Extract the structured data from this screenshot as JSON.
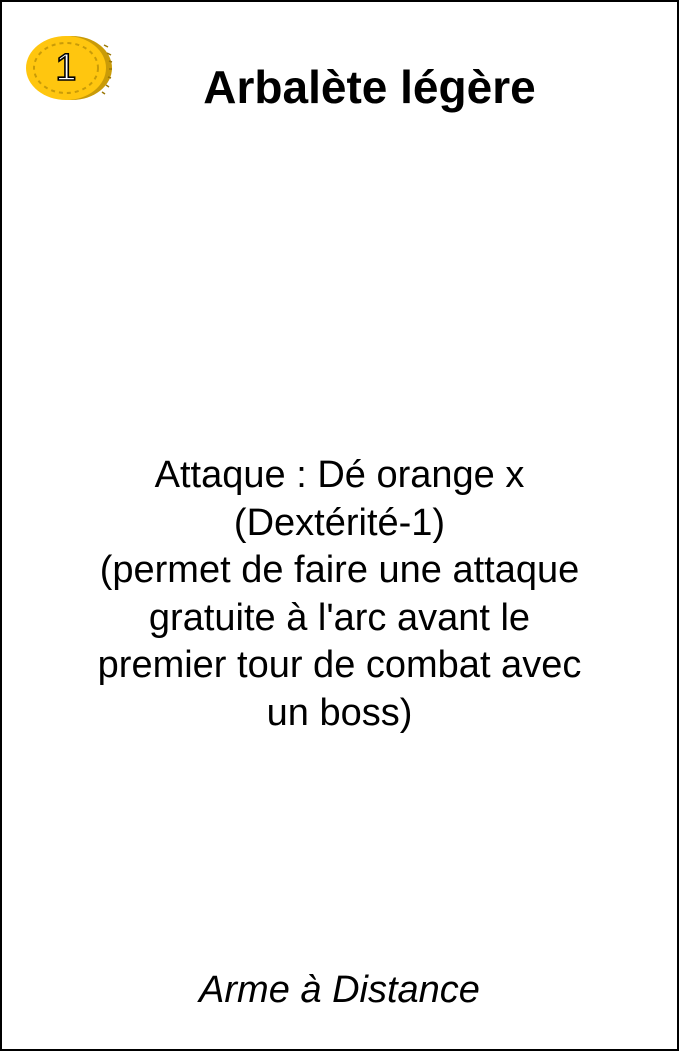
{
  "card": {
    "cost": "1",
    "title": "Arbalète légère",
    "effect_lines": [
      "Attaque : Dé orange x",
      "(Dextérité-1)",
      "(permet de faire une attaque",
      "gratuite à l'arc avant le",
      "premier tour de combat avec",
      "un boss)"
    ],
    "type": "Arme à Distance"
  },
  "colors": {
    "coin_face": "#FFC60F",
    "coin_edge": "#C99B08",
    "border": "#000000",
    "background": "#FFFFFF"
  },
  "icons": {
    "cost": "gold-coin-icon"
  }
}
